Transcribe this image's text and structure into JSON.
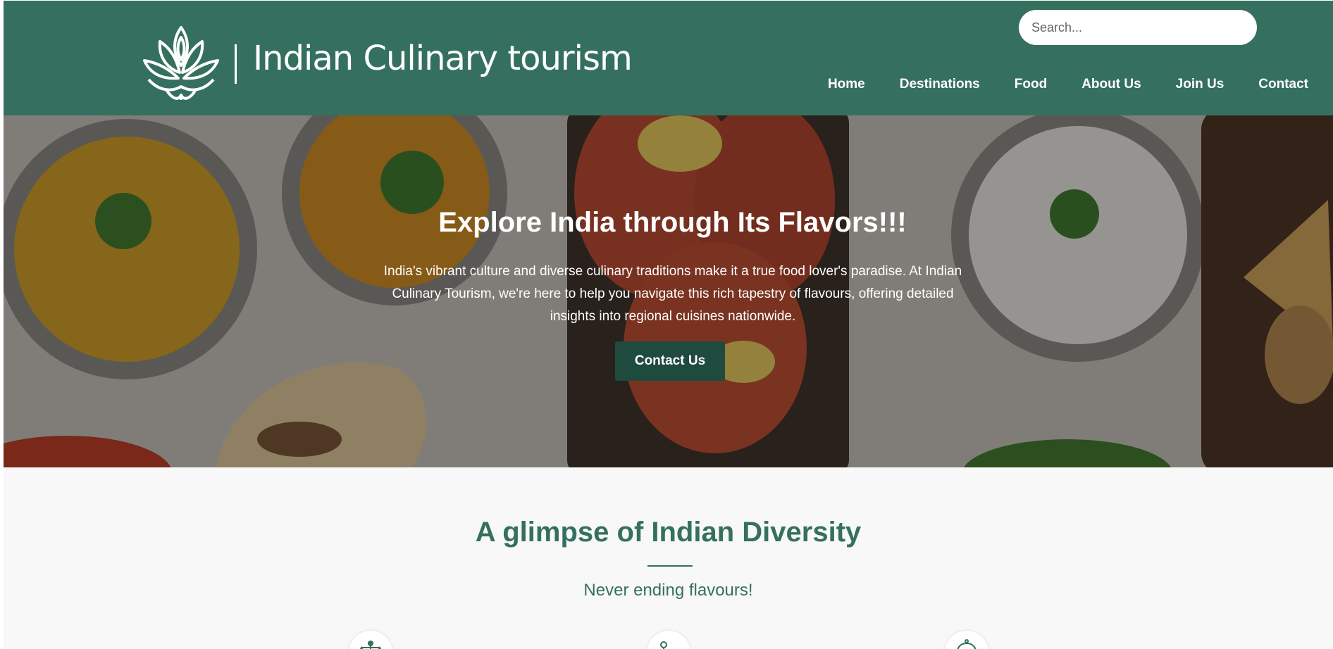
{
  "header": {
    "site_name": "Indian Culinary tourism",
    "logo_icon": "lotus-icon",
    "search_placeholder": "Search...",
    "nav": [
      {
        "label": "Home"
      },
      {
        "label": "Destinations"
      },
      {
        "label": "Food"
      },
      {
        "label": "About Us"
      },
      {
        "label": "Join Us"
      },
      {
        "label": "Contact"
      }
    ]
  },
  "hero": {
    "title": "Explore India through Its Flavors!!!",
    "text": "India's vibrant culture and diverse culinary traditions make it a true food lover's paradise. At Indian Culinary Tourism, we're here to help you navigate this rich tapestry of flavours, offering detailed insights into regional cuisines nationwide.",
    "button_label": "Contact Us"
  },
  "section": {
    "title": "A glimpse of Indian Diversity",
    "subtitle": "Never ending flavours!",
    "feature_icons": [
      "balance-icon",
      "map-route-icon",
      "cloche-icon"
    ]
  },
  "colors": {
    "brand_green": "#35705f",
    "button_dark_green": "#1f4a3e",
    "page_background": "#f8f8f8"
  }
}
